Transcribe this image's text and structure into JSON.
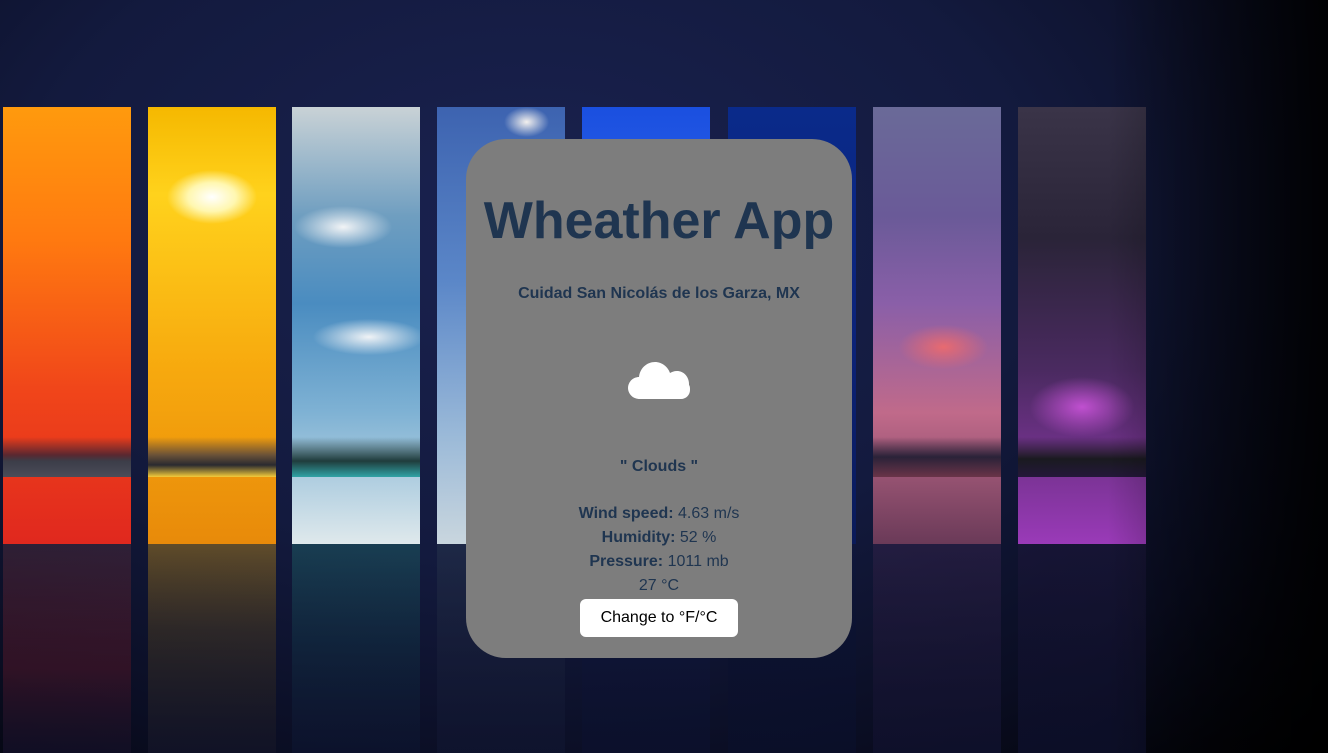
{
  "app": {
    "title": "Wheather App"
  },
  "weather": {
    "location": "Cuidad San Nicolás de los Garza, MX",
    "icon": "cloud-icon",
    "condition": "\" Clouds \"",
    "wind_label": "Wind speed:",
    "wind_value": " 4.63 m/s",
    "humidity_label": "Humidity:",
    "humidity_value": " 52 %",
    "pressure_label": "Pressure:",
    "pressure_value": " 1011 mb",
    "temperature": "27 °C"
  },
  "controls": {
    "toggle_units_label": "Change to °F/°C"
  },
  "colors": {
    "card_background": "#7d7d7d",
    "text": "#1f3550",
    "button_background": "#ffffff"
  }
}
